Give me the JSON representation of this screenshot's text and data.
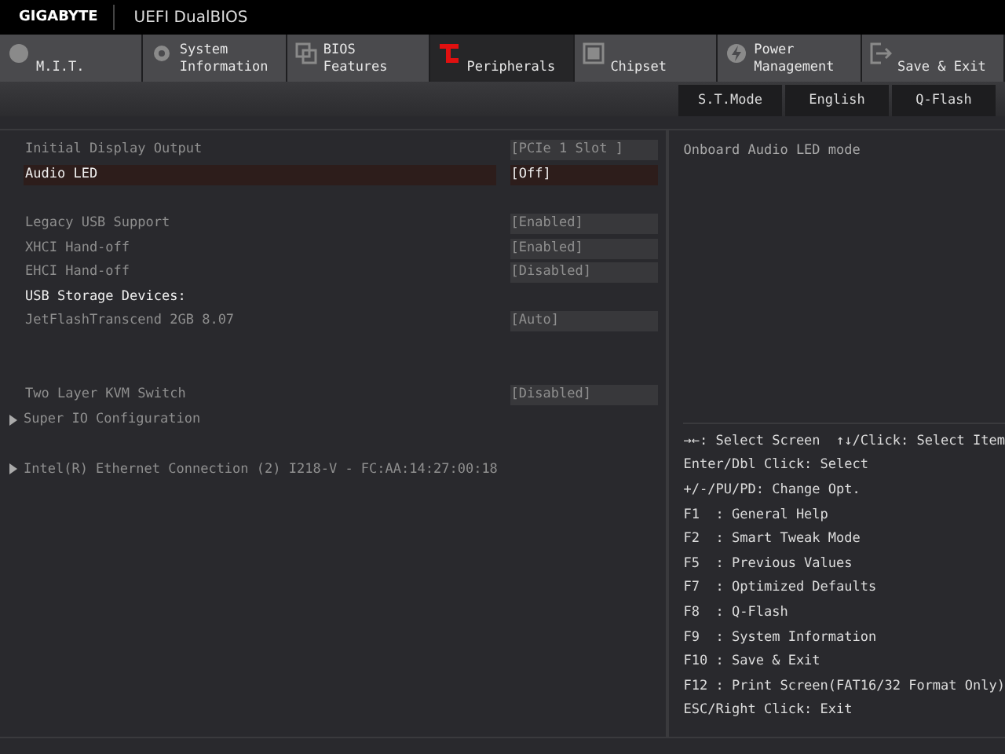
{
  "header": {
    "brand": "GIGABYTE",
    "title": "UEFI DualBIOS"
  },
  "tabs": [
    {
      "lines": [
        "M.I.T."
      ],
      "selected": false
    },
    {
      "lines": [
        "System",
        "Information"
      ],
      "selected": false
    },
    {
      "lines": [
        "BIOS",
        "Features"
      ],
      "selected": false
    },
    {
      "lines": [
        "Peripherals"
      ],
      "selected": true
    },
    {
      "lines": [
        "Chipset"
      ],
      "selected": false
    },
    {
      "lines": [
        "Power",
        "Management"
      ],
      "selected": false
    },
    {
      "lines": [
        "Save & Exit"
      ],
      "selected": false
    }
  ],
  "toolbar": [
    "S.T.Mode",
    "English",
    "Q-Flash"
  ],
  "items": [
    {
      "kind": "setting",
      "label": "Initial Display Output",
      "value": "[PCIe 1 Slot ]",
      "selected": false
    },
    {
      "kind": "setting",
      "label": "Audio LED",
      "value": "[Off]",
      "selected": true
    },
    {
      "kind": "gap"
    },
    {
      "kind": "setting",
      "label": "Legacy USB Support",
      "value": "[Enabled]",
      "selected": false
    },
    {
      "kind": "setting",
      "label": "XHCI Hand-off",
      "value": "[Enabled]",
      "selected": false
    },
    {
      "kind": "setting",
      "label": "EHCI Hand-off",
      "value": "[Disabled]",
      "selected": false
    },
    {
      "kind": "heading",
      "label": "USB Storage Devices:"
    },
    {
      "kind": "setting",
      "label": "JetFlashTranscend 2GB 8.07",
      "value": "[Auto]",
      "selected": false
    },
    {
      "kind": "gap"
    },
    {
      "kind": "gap"
    },
    {
      "kind": "setting",
      "label": "Two Layer KVM Switch",
      "value": "[Disabled]",
      "selected": false
    },
    {
      "kind": "submenu",
      "label": "Super IO Configuration"
    },
    {
      "kind": "gap"
    },
    {
      "kind": "submenu",
      "label": "Intel(R) Ethernet Connection (2) I218-V - FC:AA:14:27:00:18"
    }
  ],
  "help": {
    "description": "Onboard Audio LED mode",
    "keys": [
      "→←: Select Screen  ↑↓/Click: Select Item",
      "Enter/Dbl Click: Select",
      "+/-/PU/PD: Change Opt.",
      "F1  : General Help",
      "F2  : Smart Tweak Mode",
      "F5  : Previous Values",
      "F7  : Optimized Defaults",
      "F8  : Q-Flash",
      "F9  : System Information",
      "F10 : Save & Exit",
      "F12 : Print Screen(FAT16/32 Format Only)",
      "ESC/Right Click: Exit"
    ]
  }
}
